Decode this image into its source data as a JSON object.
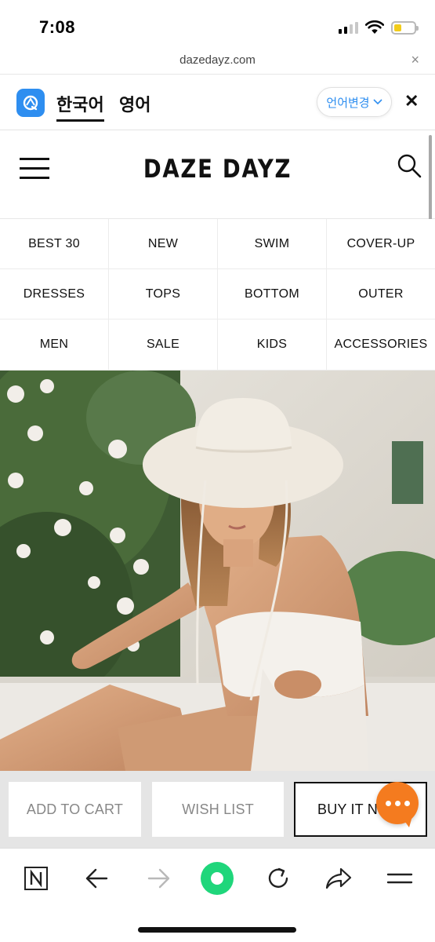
{
  "status_bar": {
    "time": "7:08"
  },
  "url_bar": {
    "domain": "dazedayz.com",
    "close_glyph": "×"
  },
  "translate_bar": {
    "tabs": [
      {
        "label": "한국어",
        "active": true
      },
      {
        "label": "영어",
        "active": false
      }
    ],
    "change_label": "언어변경",
    "close_glyph": "✕"
  },
  "site": {
    "brand": "DAZE DAYZ",
    "categories": [
      "BEST 30",
      "NEW",
      "SWIM",
      "COVER-UP",
      "DRESSES",
      "TOPS",
      "BOTTOM",
      "OUTER",
      "MEN",
      "SALE",
      "KIDS",
      "ACCESSORIES"
    ]
  },
  "actions": {
    "add_to_cart": "ADD TO CART",
    "wish_list": "WISH LIST",
    "buy_it_now": "BUY IT N"
  },
  "colors": {
    "accent_blue": "#2e8ef0",
    "chat_orange": "#f47b1f",
    "browser_green": "#1fd67b"
  },
  "icons": {
    "toolbar": [
      "naver-n-icon",
      "back-arrow-icon",
      "forward-arrow-icon",
      "green-dot-icon",
      "reload-icon",
      "share-icon",
      "menu-lines-icon"
    ]
  }
}
